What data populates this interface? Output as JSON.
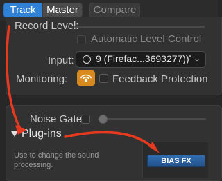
{
  "tabs": {
    "track": "Track",
    "master": "Master",
    "compare": "Compare"
  },
  "recording": {
    "record_level_label": "Record Level:",
    "automatic_level_label": "Automatic Level Control",
    "input_label": "Input:",
    "input_value": "9  (Firefac...3693277))",
    "monitoring_label": "Monitoring:",
    "feedback_protection_label": "Feedback Protection"
  },
  "plugins": {
    "noise_gate_label": "Noise Gate:",
    "section_label": "Plug-ins",
    "description": "Use to change the sound processing.",
    "slot_1": "BIAS FX"
  },
  "colors": {
    "accent_blue": "#2f82d6",
    "monitoring_orange": "#d98a1f",
    "annotation_red": "#e8391f",
    "plugin_slot_blue": "#2f6cb0"
  },
  "icons": {
    "monitoring": "speaker-waves-icon",
    "input": "mono-input-ring-icon",
    "chevron": "chevron-up-down-icon",
    "disclosure": "disclosure-triangle-down-icon"
  }
}
